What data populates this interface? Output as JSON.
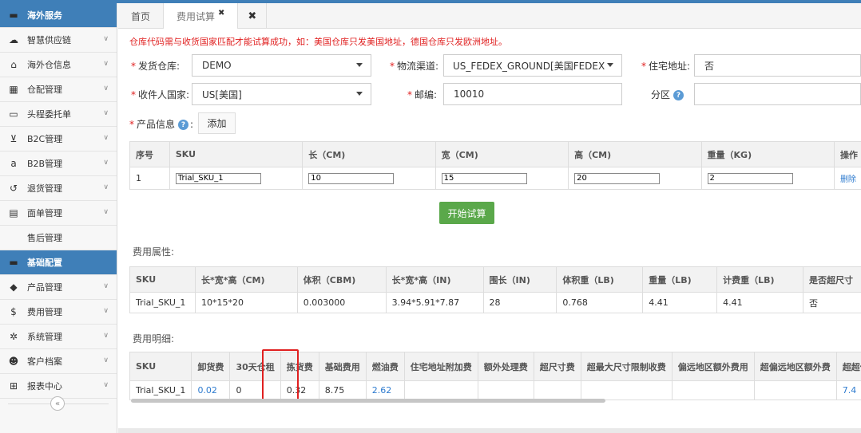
{
  "sidebar": {
    "items": [
      {
        "label": "海外服务",
        "icon": "folder-icon",
        "glyph": "▬",
        "section": true
      },
      {
        "label": "智慧供应链",
        "icon": "cloud-icon",
        "glyph": "☁"
      },
      {
        "label": "海外仓信息",
        "icon": "home-icon",
        "glyph": "⌂"
      },
      {
        "label": "仓配管理",
        "icon": "grid-icon",
        "glyph": "▦"
      },
      {
        "label": "头程委托单",
        "icon": "briefcase-icon",
        "glyph": "▭"
      },
      {
        "label": "B2C管理",
        "icon": "cart-icon",
        "glyph": "⊻"
      },
      {
        "label": "B2B管理",
        "icon": "amazon-icon",
        "glyph": "a"
      },
      {
        "label": "退货管理",
        "icon": "undo-icon",
        "glyph": "↺"
      },
      {
        "label": "面单管理",
        "icon": "file-icon",
        "glyph": "▤"
      },
      {
        "label": "售后管理",
        "icon": "",
        "glyph": "",
        "sub": true
      },
      {
        "label": "基础配置",
        "icon": "folder-icon",
        "glyph": "▬",
        "section": true
      },
      {
        "label": "产品管理",
        "icon": "tag-icon",
        "glyph": "◆"
      },
      {
        "label": "费用管理",
        "icon": "dollar-icon",
        "glyph": "$"
      },
      {
        "label": "系统管理",
        "icon": "gear-icon",
        "glyph": "✲"
      },
      {
        "label": "客户档案",
        "icon": "users-icon",
        "glyph": "☻"
      },
      {
        "label": "报表中心",
        "icon": "table-icon",
        "glyph": "⊞"
      }
    ],
    "collapse_glyph": "«"
  },
  "tabs": {
    "home": "首页",
    "fee_trial": "费用试算",
    "tab_close_glyph": "✖",
    "close_all_glyph": "✖"
  },
  "notice": "仓库代码需与收货国家匹配才能试算成功，如：美国仓库只发美国地址，德国仓库只发欧洲地址。",
  "form": {
    "warehouse_label": "发货仓库:",
    "warehouse_value": "DEMO",
    "channel_label": "物流渠道:",
    "channel_value": "US_FEDEX_GROUND[美国FEDEX_G...",
    "residential_label": "住宅地址:",
    "residential_value": "否",
    "country_label": "收件人国家:",
    "country_value": "US[美国]",
    "postcode_label": "邮编:",
    "postcode_value": "10010",
    "zone_label": "分区",
    "zone_value": "",
    "product_label": "产品信息",
    "add_button": "添加",
    "required_mark": "*",
    "help_glyph": "?"
  },
  "product_table": {
    "headers": [
      "序号",
      "SKU",
      "长（CM)",
      "宽（CM)",
      "高（CM)",
      "重量（KG)",
      "操作"
    ],
    "row": {
      "index": "1",
      "sku": "Trial_SKU_1",
      "length": "10",
      "width": "15",
      "height": "20",
      "weight": "2",
      "action": "删除"
    }
  },
  "start_button": "开始试算",
  "attr_section": {
    "title": "费用属性:",
    "headers": [
      "SKU",
      "长*宽*高（CM)",
      "体积（CBM)",
      "长*宽*高（IN)",
      "围长（IN)",
      "体积重（LB)",
      "重量（LB)",
      "计费重（LB)",
      "是否超尺寸"
    ],
    "row": [
      "Trial_SKU_1",
      "10*15*20",
      "0.003000",
      "3.94*5.91*7.87",
      "28",
      "0.768",
      "4.41",
      "4.41",
      "否"
    ]
  },
  "detail_section": {
    "title": "费用明细:",
    "headers": [
      "SKU",
      "卸货费",
      "30天仓租",
      "拣货费",
      "基础费用",
      "燃油费",
      "住宅地址附加费",
      "额外处理费",
      "超尺寸费",
      "超最大尺寸限制收费",
      "偏远地区额外费用",
      "超偏远地区额外费",
      "超超偏远地区"
    ],
    "row": [
      "Trial_SKU_1",
      "0.02",
      "0",
      "0.32",
      "8.75",
      "2.62",
      "",
      "",
      "",
      "",
      "",
      "",
      "7.4"
    ],
    "link_cells": [
      1,
      5,
      12
    ]
  },
  "colors": {
    "accent": "#3f7fb8",
    "required": "#e02020",
    "start_button": "#5aa84a",
    "link": "#2e7bcf",
    "highlight_box": "#e02020"
  }
}
